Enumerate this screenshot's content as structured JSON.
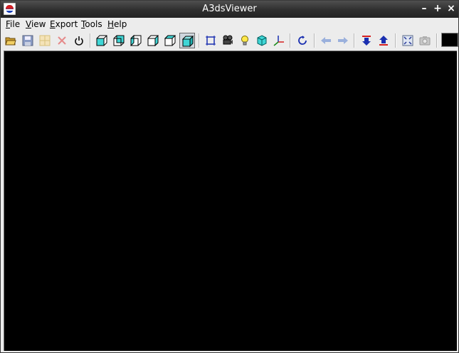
{
  "window": {
    "title": "A3dsViewer"
  },
  "window_controls": {
    "minimize": "–",
    "maximize": "+",
    "close": "×"
  },
  "menu": [
    {
      "label_u": "F",
      "label_rest": "ile"
    },
    {
      "label_u": "V",
      "label_rest": "iew"
    },
    {
      "label_u": "E",
      "label_rest": "xport"
    },
    {
      "label_u": "T",
      "label_rest": "ools"
    },
    {
      "label_u": "H",
      "label_rest": "elp"
    }
  ],
  "toolbar": {
    "icons": [
      "open-folder-icon",
      "save-icon",
      "grid-icon",
      "close-icon",
      "power-icon",
      "view-cube-front-icon",
      "view-cube-back-icon",
      "view-cube-left-icon",
      "view-cube-right-icon",
      "view-cube-top-icon",
      "view-cube-perspective-icon",
      "frame-icon",
      "camera-icon",
      "light-bulb-icon",
      "object-cube-icon",
      "axes-icon",
      "rotate-icon",
      "arrow-left-icon",
      "arrow-right-icon",
      "import-down-icon",
      "export-up-icon",
      "fullscreen-icon",
      "screenshot-icon"
    ],
    "pressed": "view-cube-perspective-icon",
    "background_color": "#000000"
  },
  "viewport": {
    "background": "#000000"
  }
}
